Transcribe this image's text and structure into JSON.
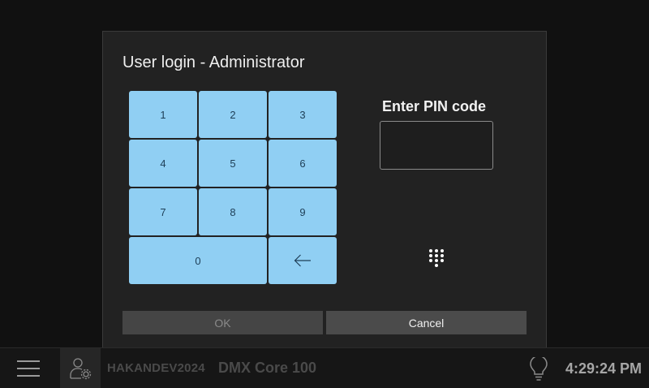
{
  "dialog": {
    "title": "User login - Administrator",
    "pin_label": "Enter PIN code",
    "pin_value": "",
    "ok_label": "OK",
    "cancel_label": "Cancel"
  },
  "keypad": {
    "keys": [
      "1",
      "2",
      "3",
      "4",
      "5",
      "6",
      "7",
      "8",
      "9",
      "0"
    ],
    "backspace_icon": "arrow-left-icon",
    "key_color": "#90cff3"
  },
  "taskbar": {
    "device_name": "HAKANDEV2024",
    "product_name": "DMX Core 100",
    "clock": "4:29:24 PM"
  }
}
